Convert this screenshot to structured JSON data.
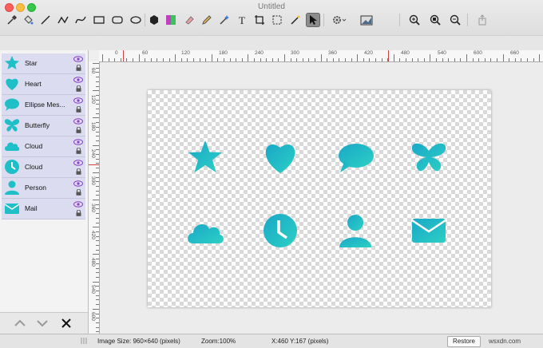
{
  "window": {
    "title": "Untitled"
  },
  "toolbar": {
    "tools": [
      "eyedropper-icon",
      "fill-bucket-icon",
      "line-icon",
      "zigzag-line-icon",
      "curve-icon",
      "rectangle-icon",
      "rounded-rectangle-icon",
      "ellipse-icon",
      "polygon-icon",
      "gradient-icon",
      "eraser-icon",
      "pencil-icon",
      "magic-wand-icon",
      "text-icon",
      "crop-icon",
      "select-rect-icon",
      "magic-select-icon",
      "pointer-icon",
      "gear-icon",
      "image-size-icon",
      "zoom-in-icon",
      "zoom-actual-icon",
      "zoom-out-icon",
      "share-icon"
    ]
  },
  "sidebar": {
    "layers": [
      {
        "label": "Star",
        "icon": "star-icon"
      },
      {
        "label": "Heart",
        "icon": "heart-icon"
      },
      {
        "label": "Ellipse Mes...",
        "icon": "speech-bubble-icon"
      },
      {
        "label": "Butterfly",
        "icon": "butterfly-icon"
      },
      {
        "label": "Cloud",
        "icon": "cloud-icon"
      },
      {
        "label": "Cloud",
        "icon": "clock-icon"
      },
      {
        "label": "Person",
        "icon": "person-icon"
      },
      {
        "label": "Mail",
        "icon": "mail-icon"
      }
    ]
  },
  "rulers": {
    "top_labels": [
      "0",
      "60",
      "120",
      "180",
      "240",
      "300",
      "360",
      "420",
      "480",
      "540",
      "600",
      "660"
    ],
    "left_labels": [
      "60",
      "120",
      "180",
      "240",
      "300",
      "360",
      "420",
      "480",
      "540",
      "600"
    ]
  },
  "status": {
    "image_size": "Image Size: 960×640 (pixels)",
    "zoom": "Zoom:100%",
    "coords": "X:460 Y:167 (pixels)",
    "restore_label": "Restore",
    "watermark": "wsxdn.com"
  },
  "colors": {
    "accent": "#1fbfc8",
    "layer_bg": "#dcdcf0"
  }
}
